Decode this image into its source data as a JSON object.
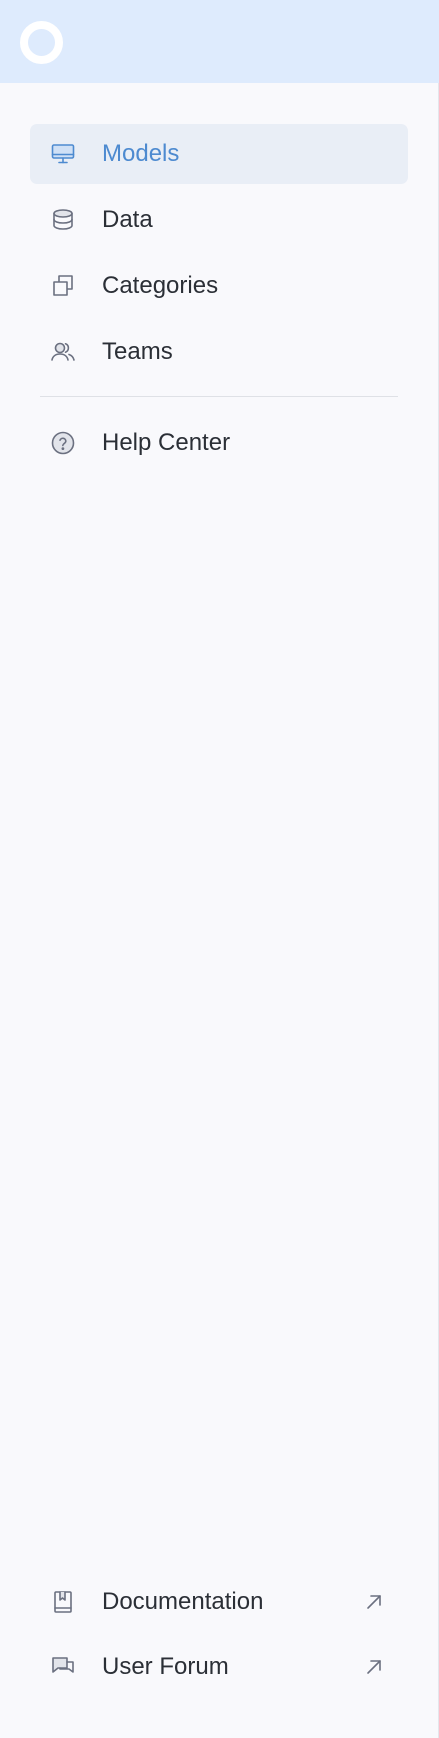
{
  "sidebar": {
    "logo_icon": "circle-ring-icon",
    "colors": {
      "header_bg": "#deebfd",
      "active_bg": "#e9eef6",
      "active_text": "#4d8ad0",
      "text": "#2b2f36",
      "icon": "#6b7080"
    },
    "nav_items": [
      {
        "label": "Models",
        "icon": "monitor-icon",
        "active": true
      },
      {
        "label": "Data",
        "icon": "database-icon",
        "active": false
      },
      {
        "label": "Categories",
        "icon": "squares-icon",
        "active": false
      },
      {
        "label": "Teams",
        "icon": "users-icon",
        "active": false
      }
    ],
    "secondary_items": [
      {
        "label": "Help Center",
        "icon": "question-circle-icon"
      }
    ],
    "footer_items": [
      {
        "label": "Documentation",
        "icon": "book-icon",
        "trailing_icon": "external-link-icon"
      },
      {
        "label": "User Forum",
        "icon": "chat-icon",
        "trailing_icon": "external-link-icon"
      }
    ]
  }
}
